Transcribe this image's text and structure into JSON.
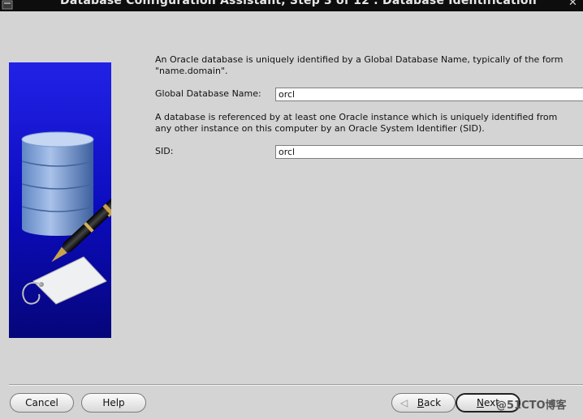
{
  "window": {
    "title": "Database Configuration Assistant, Step 3 of 12 : Database Identification",
    "icons": {
      "app": "dbca-app-icon",
      "close": "close-icon"
    }
  },
  "instructions": {
    "global_name": "An Oracle database is uniquely identified by a Global Database Name, typically of the form\n\"name.domain\".",
    "sid": "A database is referenced by at least one Oracle instance which is uniquely identified from\nany other instance on this computer by an Oracle System Identifier (SID)."
  },
  "fields": {
    "global_db_name": {
      "label": "Global Database Name:",
      "value": "orcl"
    },
    "sid": {
      "label": "SID:",
      "value": "orcl"
    }
  },
  "buttons": {
    "cancel": "Cancel",
    "help": "Help",
    "back": {
      "mnemonic": "B",
      "rest": "ack"
    },
    "next": {
      "mnemonic": "N",
      "rest": "ext"
    }
  },
  "illustration": {
    "icon": "database-pen-illustration"
  },
  "watermark": "@51CTO博客",
  "colors": {
    "titlebar": "#0d0d0d",
    "panel_blue": "#1010c8",
    "background": "#d4d4d4"
  }
}
